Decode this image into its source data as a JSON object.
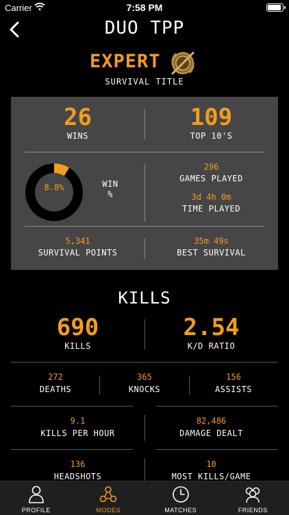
{
  "status_bar": {
    "carrier": "Carrier",
    "time": "7:58 PM"
  },
  "header": {
    "title": "DUO TPP"
  },
  "rank": {
    "name": "EXPERT",
    "subtitle": "SURVIVAL TITLE"
  },
  "survival": {
    "wins": {
      "value": "26",
      "label": "WINS"
    },
    "top10": {
      "value": "109",
      "label": "TOP 10'S"
    },
    "win_pct": {
      "value": "8.8%",
      "fraction": 0.088,
      "label_line1": "WIN",
      "label_line2": "%"
    },
    "games_played": {
      "value": "296",
      "label": "GAMES PLAYED"
    },
    "time_played": {
      "value": "3d 4h 0m",
      "label": "TIME PLAYED"
    },
    "survival_points": {
      "value": "5,341",
      "label": "SURVIVAL POINTS"
    },
    "best_survival": {
      "value": "35m 49s",
      "label": "BEST SURVIVAL"
    }
  },
  "kills": {
    "title": "KILLS",
    "kills": {
      "value": "690",
      "label": "KILLS"
    },
    "kd": {
      "value": "2.54",
      "label": "K/D RATIO"
    },
    "deaths": {
      "value": "272",
      "label": "DEATHS"
    },
    "knocks": {
      "value": "365",
      "label": "KNOCKS"
    },
    "assists": {
      "value": "156",
      "label": "ASSISTS"
    },
    "kills_per_hour": {
      "value": "9.1",
      "label": "KILLS PER HOUR"
    },
    "damage_dealt": {
      "value": "82,486",
      "label": "DAMAGE DEALT"
    },
    "headshots": {
      "value": "136",
      "label": "HEADSHOTS"
    },
    "most_kills": {
      "value": "10",
      "label": "MOST KILLS/GAME"
    }
  },
  "tabs": [
    {
      "label": "PROFILE",
      "icon": "person-icon",
      "active": false
    },
    {
      "label": "MODES",
      "icon": "modes-icon",
      "active": true
    },
    {
      "label": "MATCHES",
      "icon": "clock-icon",
      "active": false
    },
    {
      "label": "FRIENDS",
      "icon": "friends-icon",
      "active": false
    }
  ],
  "colors": {
    "accent": "#f39c1f",
    "card_bg": "#464646",
    "background": "#000000",
    "tabbar_bg": "#1f1f1f"
  }
}
